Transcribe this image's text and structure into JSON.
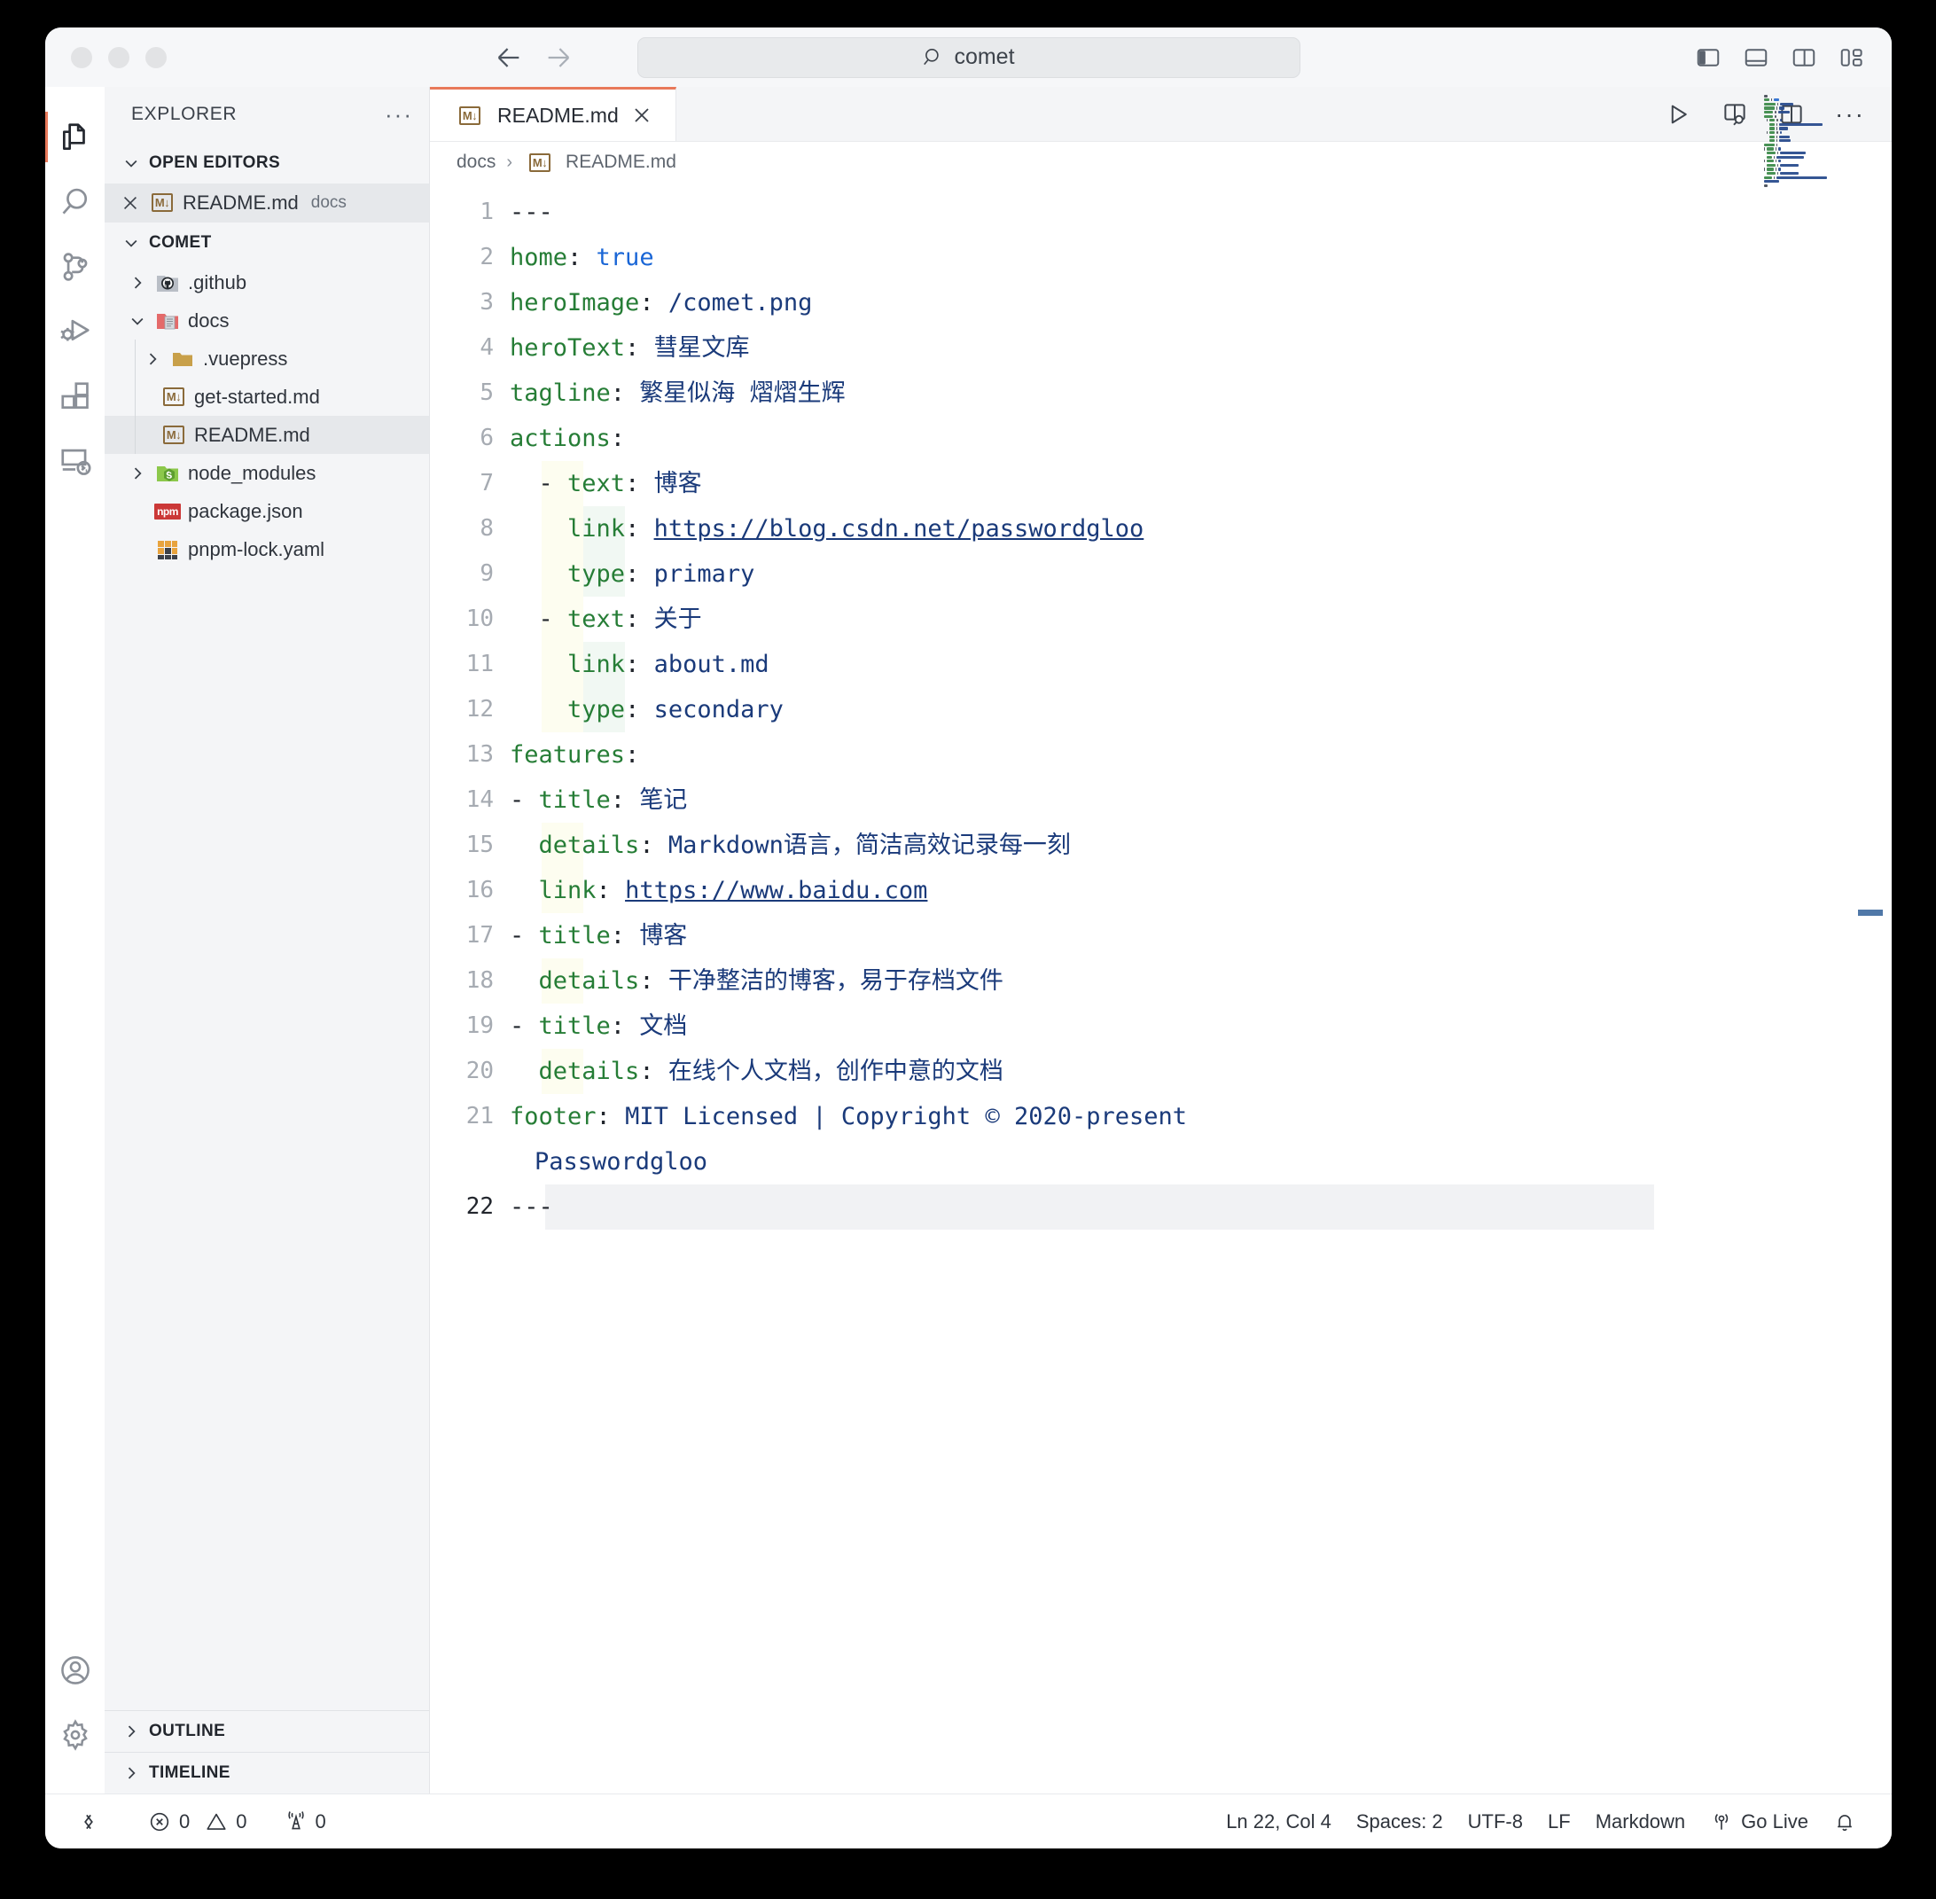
{
  "titlebar": {
    "search_value": "comet",
    "search_icon": "search-icon",
    "back_icon": "arrow-left-icon",
    "forward_icon": "arrow-right-icon",
    "layout_toggles": [
      {
        "name": "toggle-primary-sidebar-icon",
        "label": "Toggle Primary Side Bar"
      },
      {
        "name": "toggle-panel-icon",
        "label": "Toggle Panel"
      },
      {
        "name": "toggle-secondary-sidebar-icon",
        "label": "Toggle Secondary Side Bar"
      },
      {
        "name": "customize-layout-icon",
        "label": "Customize Layout"
      }
    ]
  },
  "activitybar": {
    "items": [
      {
        "name": "explorer-icon",
        "label": "Explorer",
        "active": true
      },
      {
        "name": "search-icon",
        "label": "Search",
        "active": false
      },
      {
        "name": "source-control-icon",
        "label": "Source Control",
        "active": false
      },
      {
        "name": "run-and-debug-icon",
        "label": "Run and Debug",
        "active": false
      },
      {
        "name": "extensions-icon",
        "label": "Extensions",
        "active": false
      },
      {
        "name": "remote-explorer-icon",
        "label": "Remote Explorer",
        "active": false
      }
    ],
    "bottom": [
      {
        "name": "accounts-icon",
        "label": "Accounts"
      },
      {
        "name": "settings-gear-icon",
        "label": "Manage"
      }
    ]
  },
  "sidebar": {
    "title": "EXPLORER",
    "more_actions": "···",
    "open_editors": {
      "label": "OPEN EDITORS",
      "items": [
        {
          "name": "README.md",
          "meta": "docs",
          "icon": "markdown-icon",
          "selected": true
        }
      ]
    },
    "project": {
      "label": "COMET",
      "tree": [
        {
          "name": ".github",
          "icon": "github-folder-icon",
          "twisty": "collapsed",
          "depth": 0,
          "selected": false
        },
        {
          "name": "docs",
          "icon": "docs-folder-icon",
          "twisty": "expanded",
          "depth": 0,
          "selected": false
        },
        {
          "name": ".vuepress",
          "icon": "folder-icon",
          "twisty": "collapsed",
          "depth": 1,
          "selected": false
        },
        {
          "name": "get-started.md",
          "icon": "markdown-icon",
          "twisty": "none",
          "depth": 1,
          "selected": false
        },
        {
          "name": "README.md",
          "icon": "markdown-icon",
          "twisty": "none",
          "depth": 1,
          "selected": true
        },
        {
          "name": "node_modules",
          "icon": "node-folder-icon",
          "twisty": "collapsed",
          "depth": 0,
          "selected": false
        },
        {
          "name": "package.json",
          "icon": "npm-icon",
          "twisty": "none",
          "depth": 0,
          "selected": false
        },
        {
          "name": "pnpm-lock.yaml",
          "icon": "yaml-icon",
          "twisty": "none",
          "depth": 0,
          "selected": false
        }
      ]
    },
    "panels": [
      {
        "label": "OUTLINE",
        "state": "collapsed"
      },
      {
        "label": "TIMELINE",
        "state": "collapsed"
      }
    ]
  },
  "editor": {
    "tab": {
      "label": "README.md",
      "icon": "markdown-icon",
      "close": "close-icon",
      "dirty": false
    },
    "actions": [
      {
        "name": "run-icon",
        "label": "Run"
      },
      {
        "name": "open-preview-to-side-icon",
        "label": "Open Preview to the Side"
      },
      {
        "name": "split-editor-icon",
        "label": "Split Editor"
      },
      {
        "name": "more-actions-icon",
        "label": "More Actions..."
      }
    ],
    "breadcrumb": [
      {
        "label": "docs",
        "icon": null
      },
      {
        "label": "README.md",
        "icon": "markdown-icon"
      }
    ],
    "language": "yaml-frontmatter",
    "lines": [
      {
        "n": "1",
        "indents": [],
        "tokens": [
          {
            "t": "---",
            "c": "dash"
          }
        ]
      },
      {
        "n": "2",
        "indents": [],
        "tokens": [
          {
            "t": "home",
            "c": "k"
          },
          {
            "t": ": ",
            "c": "dash"
          },
          {
            "t": "true",
            "c": "bool"
          }
        ]
      },
      {
        "n": "3",
        "indents": [],
        "tokens": [
          {
            "t": "heroImage",
            "c": "k"
          },
          {
            "t": ": ",
            "c": "dash"
          },
          {
            "t": "/comet.png",
            "c": "v"
          }
        ]
      },
      {
        "n": "4",
        "indents": [],
        "tokens": [
          {
            "t": "heroText",
            "c": "k"
          },
          {
            "t": ": ",
            "c": "dash"
          },
          {
            "t": "彗星文库",
            "c": "v"
          }
        ]
      },
      {
        "n": "5",
        "indents": [],
        "tokens": [
          {
            "t": "tagline",
            "c": "k"
          },
          {
            "t": ": ",
            "c": "dash"
          },
          {
            "t": "繁星似海 熠熠生辉",
            "c": "v"
          }
        ]
      },
      {
        "n": "6",
        "indents": [],
        "tokens": [
          {
            "t": "actions",
            "c": "k"
          },
          {
            "t": ":",
            "c": "dash"
          }
        ]
      },
      {
        "n": "7",
        "indents": [
          "y"
        ],
        "tokens": [
          {
            "t": "  - ",
            "c": "dash"
          },
          {
            "t": "text",
            "c": "k"
          },
          {
            "t": ": ",
            "c": "dash"
          },
          {
            "t": "博客",
            "c": "v"
          }
        ]
      },
      {
        "n": "8",
        "indents": [
          "y",
          "g"
        ],
        "tokens": [
          {
            "t": "    ",
            "c": "dash"
          },
          {
            "t": "link",
            "c": "k"
          },
          {
            "t": ": ",
            "c": "dash"
          },
          {
            "t": "https://blog.csdn.net/passwordgloo",
            "c": "link"
          }
        ]
      },
      {
        "n": "9",
        "indents": [
          "y",
          "g"
        ],
        "tokens": [
          {
            "t": "    ",
            "c": "dash"
          },
          {
            "t": "type",
            "c": "k"
          },
          {
            "t": ": ",
            "c": "dash"
          },
          {
            "t": "primary",
            "c": "v"
          }
        ]
      },
      {
        "n": "10",
        "indents": [
          "y"
        ],
        "tokens": [
          {
            "t": "  - ",
            "c": "dash"
          },
          {
            "t": "text",
            "c": "k"
          },
          {
            "t": ": ",
            "c": "dash"
          },
          {
            "t": "关于",
            "c": "v"
          }
        ]
      },
      {
        "n": "11",
        "indents": [
          "y",
          "g"
        ],
        "tokens": [
          {
            "t": "    ",
            "c": "dash"
          },
          {
            "t": "link",
            "c": "k"
          },
          {
            "t": ": ",
            "c": "dash"
          },
          {
            "t": "about.md",
            "c": "v"
          }
        ]
      },
      {
        "n": "12",
        "indents": [
          "y",
          "g"
        ],
        "tokens": [
          {
            "t": "    ",
            "c": "dash"
          },
          {
            "t": "type",
            "c": "k"
          },
          {
            "t": ": ",
            "c": "dash"
          },
          {
            "t": "secondary",
            "c": "v"
          }
        ]
      },
      {
        "n": "13",
        "indents": [],
        "tokens": [
          {
            "t": "features",
            "c": "k"
          },
          {
            "t": ":",
            "c": "dash"
          }
        ]
      },
      {
        "n": "14",
        "indents": [],
        "tokens": [
          {
            "t": "- ",
            "c": "dash"
          },
          {
            "t": "title",
            "c": "k"
          },
          {
            "t": ": ",
            "c": "dash"
          },
          {
            "t": "笔记",
            "c": "v"
          }
        ]
      },
      {
        "n": "15",
        "indents": [
          "y"
        ],
        "tokens": [
          {
            "t": "  ",
            "c": "dash"
          },
          {
            "t": "details",
            "c": "k"
          },
          {
            "t": ": ",
            "c": "dash"
          },
          {
            "t": "Markdown语言，简洁高效记录每一刻",
            "c": "v"
          }
        ]
      },
      {
        "n": "16",
        "indents": [
          "y"
        ],
        "tokens": [
          {
            "t": "  ",
            "c": "dash"
          },
          {
            "t": "link",
            "c": "k"
          },
          {
            "t": ": ",
            "c": "dash"
          },
          {
            "t": "https://www.baidu.com",
            "c": "link"
          }
        ]
      },
      {
        "n": "17",
        "indents": [],
        "tokens": [
          {
            "t": "- ",
            "c": "dash"
          },
          {
            "t": "title",
            "c": "k"
          },
          {
            "t": ": ",
            "c": "dash"
          },
          {
            "t": "博客",
            "c": "v"
          }
        ]
      },
      {
        "n": "18",
        "indents": [
          "y"
        ],
        "tokens": [
          {
            "t": "  ",
            "c": "dash"
          },
          {
            "t": "details",
            "c": "k"
          },
          {
            "t": ": ",
            "c": "dash"
          },
          {
            "t": "干净整洁的博客，易于存档文件",
            "c": "v"
          }
        ]
      },
      {
        "n": "19",
        "indents": [],
        "tokens": [
          {
            "t": "- ",
            "c": "dash"
          },
          {
            "t": "title",
            "c": "k"
          },
          {
            "t": ": ",
            "c": "dash"
          },
          {
            "t": "文档",
            "c": "v"
          }
        ]
      },
      {
        "n": "20",
        "indents": [
          "y"
        ],
        "tokens": [
          {
            "t": "  ",
            "c": "dash"
          },
          {
            "t": "details",
            "c": "k"
          },
          {
            "t": ": ",
            "c": "dash"
          },
          {
            "t": "在线个人文档，创作中意的文档",
            "c": "v"
          }
        ]
      },
      {
        "n": "21",
        "indents": [],
        "tokens": [
          {
            "t": "footer",
            "c": "k"
          },
          {
            "t": ": ",
            "c": "dash"
          },
          {
            "t": "MIT Licensed | Copyright © 2020-present",
            "c": "v"
          }
        ],
        "wrap": [
          {
            "t": "Passwordgloo",
            "c": "v"
          }
        ]
      },
      {
        "n": "22",
        "indents": [],
        "active": true,
        "tokens": [
          {
            "t": "---",
            "c": "dash"
          }
        ]
      }
    ],
    "colors": {
      "key": "#267d36",
      "value": "#1a3a7a",
      "boolean": "#1a66d6",
      "punctuation": "#22262d",
      "indent_level1_bg": "#fdfdf0",
      "indent_level2_bg": "#f1f8f3",
      "active_line_bg": "#f1f2f4",
      "tab_accent": "#e8795a",
      "overview_marker": "#5078a8"
    }
  },
  "statusbar": {
    "remote_icon": "remote-window-icon",
    "errors": {
      "icon": "error-icon",
      "count": "0"
    },
    "warnings": {
      "icon": "warning-icon",
      "count": "0"
    },
    "ports": {
      "icon": "radio-tower-icon",
      "count": "0"
    },
    "cursor": "Ln 22, Col 4",
    "indentation": "Spaces: 2",
    "encoding": "UTF-8",
    "eol": "LF",
    "language": "Markdown",
    "golive": {
      "icon": "broadcast-icon",
      "label": "Go Live"
    },
    "notifications_icon": "bell-icon"
  }
}
